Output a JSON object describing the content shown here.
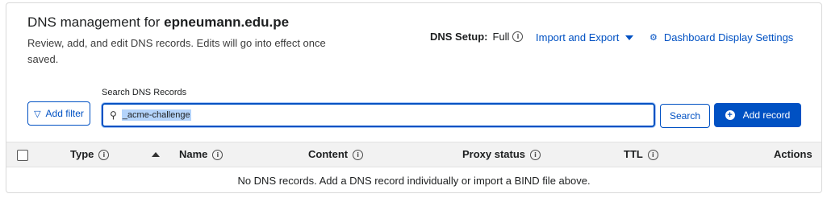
{
  "header": {
    "title_prefix": "DNS management for ",
    "domain": "epneumann.edu.pe",
    "description": "Review, add, and edit DNS records. Edits will go into effect once saved."
  },
  "setup": {
    "label": "DNS Setup:",
    "value": "Full"
  },
  "links": {
    "import_export": "Import and Export",
    "dashboard_settings": "Dashboard Display Settings"
  },
  "search": {
    "label": "Search DNS Records",
    "value": "_acme-challenge",
    "button": "Search"
  },
  "toolbar": {
    "add_filter": "Add filter",
    "add_record": "Add record"
  },
  "table": {
    "columns": [
      "Type",
      "Name",
      "Content",
      "Proxy status",
      "TTL",
      "Actions"
    ],
    "empty_message": "No DNS records. Add a DNS record individually or import a BIND file above."
  },
  "icons": {
    "info": "info-icon",
    "caret": "caret-down-icon",
    "gear": "gear-icon",
    "filter": "filter-icon",
    "search": "search-icon",
    "add": "plus-circle-icon",
    "sort": "sort-ascending-icon"
  },
  "colors": {
    "accent": "#0051c3",
    "header_bg": "#f2f2f2",
    "highlight": "#b4d4fb"
  }
}
